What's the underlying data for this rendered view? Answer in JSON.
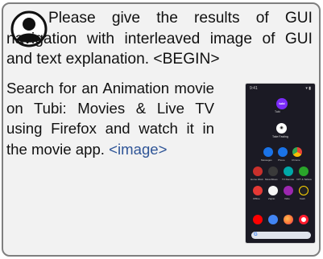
{
  "prompt": {
    "text": "Please give the results of GUI navigation with interleaved image of GUI and text explanation. <BEGIN>",
    "task": "Search for an Animation movie on Tubi: Movies & Live TV using Firefox and watch it in the movie app.",
    "image_token": "<image>"
  },
  "phone": {
    "tubi_icon_text": "tubi",
    "tubi_label": "Tubi",
    "widget_label": "Take Fasting",
    "dock_row1_labels": [
      "Messages",
      "Phone",
      "Chrome"
    ],
    "dock_row2_labels": [
      "Home Work",
      "MusicMixes",
      "TV Remote",
      "VPT & Tablets"
    ],
    "dock_row3_labels": [
      "Offline",
      "Zapito",
      "Vidio",
      "Kash"
    ],
    "colors": {
      "tubi": "#7b2bf9",
      "chrome": "#34a853",
      "phone_app": "#1a73e8",
      "youtube": "#ff0000",
      "firefox": "#ff7139",
      "opera": "#ff1b2d"
    }
  }
}
